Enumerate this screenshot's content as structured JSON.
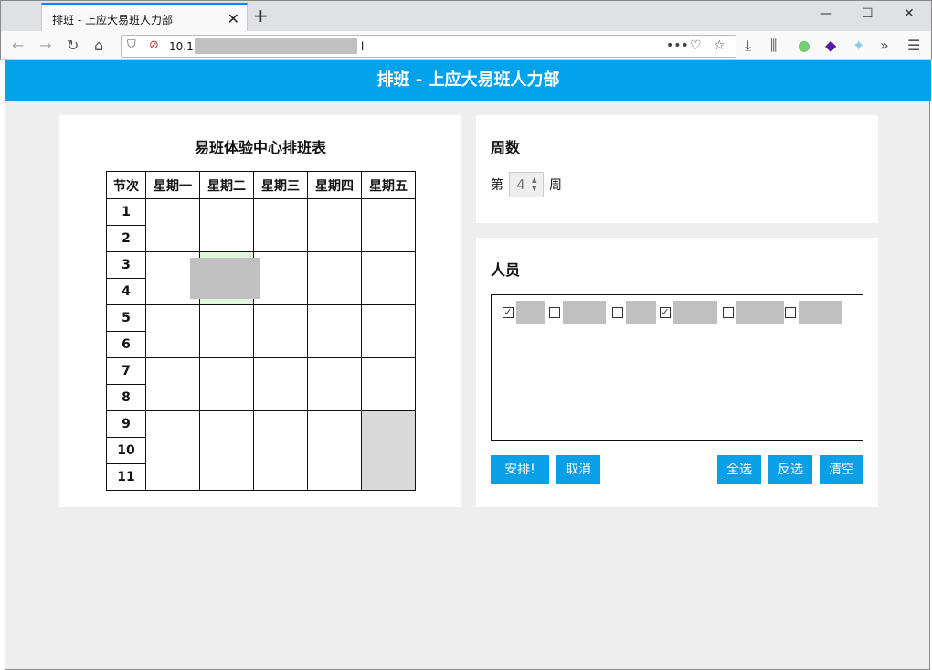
{
  "browser": {
    "tab_title": "排班 - 上应大易班人力部",
    "url_prefix": "10.1",
    "url_suffix": "l"
  },
  "page": {
    "header_title": "排班 - 上应大易班人力部"
  },
  "schedule": {
    "title": "易班体验中心排班表",
    "columns": [
      "节次",
      "星期一",
      "星期二",
      "星期三",
      "星期四",
      "星期五"
    ],
    "lessons": [
      "1",
      "2",
      "3",
      "4",
      "5",
      "6",
      "7",
      "8",
      "9",
      "10",
      "11"
    ]
  },
  "week": {
    "title": "周数",
    "prefix": "第",
    "value": "4",
    "suffix": "周"
  },
  "people": {
    "title": "人员",
    "items": [
      {
        "checked": true
      },
      {
        "checked": false
      },
      {
        "checked": false
      },
      {
        "checked": true
      },
      {
        "checked": false
      },
      {
        "checked": false
      }
    ]
  },
  "buttons": {
    "arrange": "安排!",
    "cancel": "取消",
    "select_all": "全选",
    "invert": "反选",
    "clear": "清空"
  },
  "colors": {
    "header": "#00a3ea",
    "button": "#0aa0e8",
    "slot_green": "#dff5dc",
    "slot_gray": "#d9d9d9"
  }
}
